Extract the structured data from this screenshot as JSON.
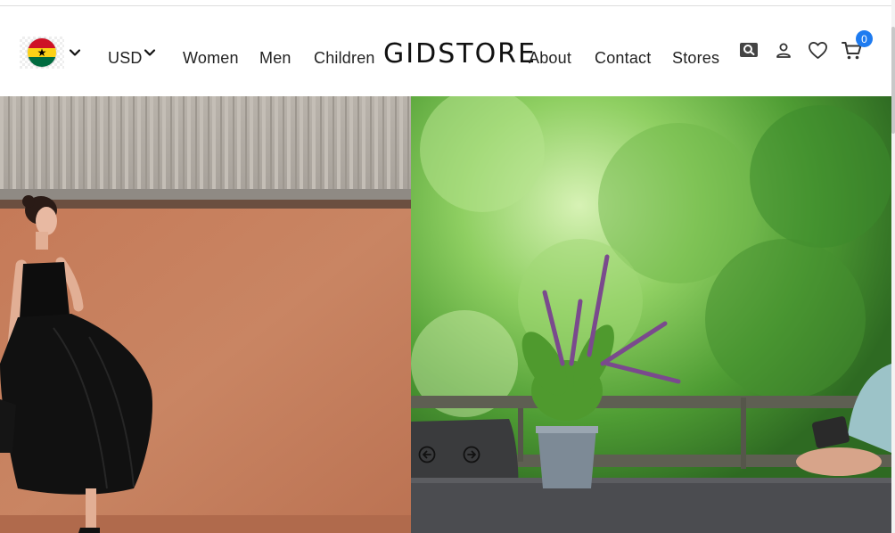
{
  "header": {
    "currency": "USD",
    "nav_left": [
      "Women",
      "Men",
      "Children"
    ],
    "logo": "GIDSTORE",
    "nav_right": [
      "About",
      "Contact",
      "Stores"
    ],
    "cart_count": "0"
  },
  "icons": {
    "flag": "ghana-flag-icon",
    "search": "search-icon",
    "account": "user-icon",
    "wishlist": "heart-icon",
    "cart": "cart-icon",
    "prev": "arrow-left-circle-icon",
    "next": "arrow-right-circle-icon"
  },
  "colors": {
    "badge": "#1e7bf0",
    "ghana_red": "#ce1126",
    "ghana_gold": "#fcd116",
    "ghana_green": "#006b3f"
  }
}
